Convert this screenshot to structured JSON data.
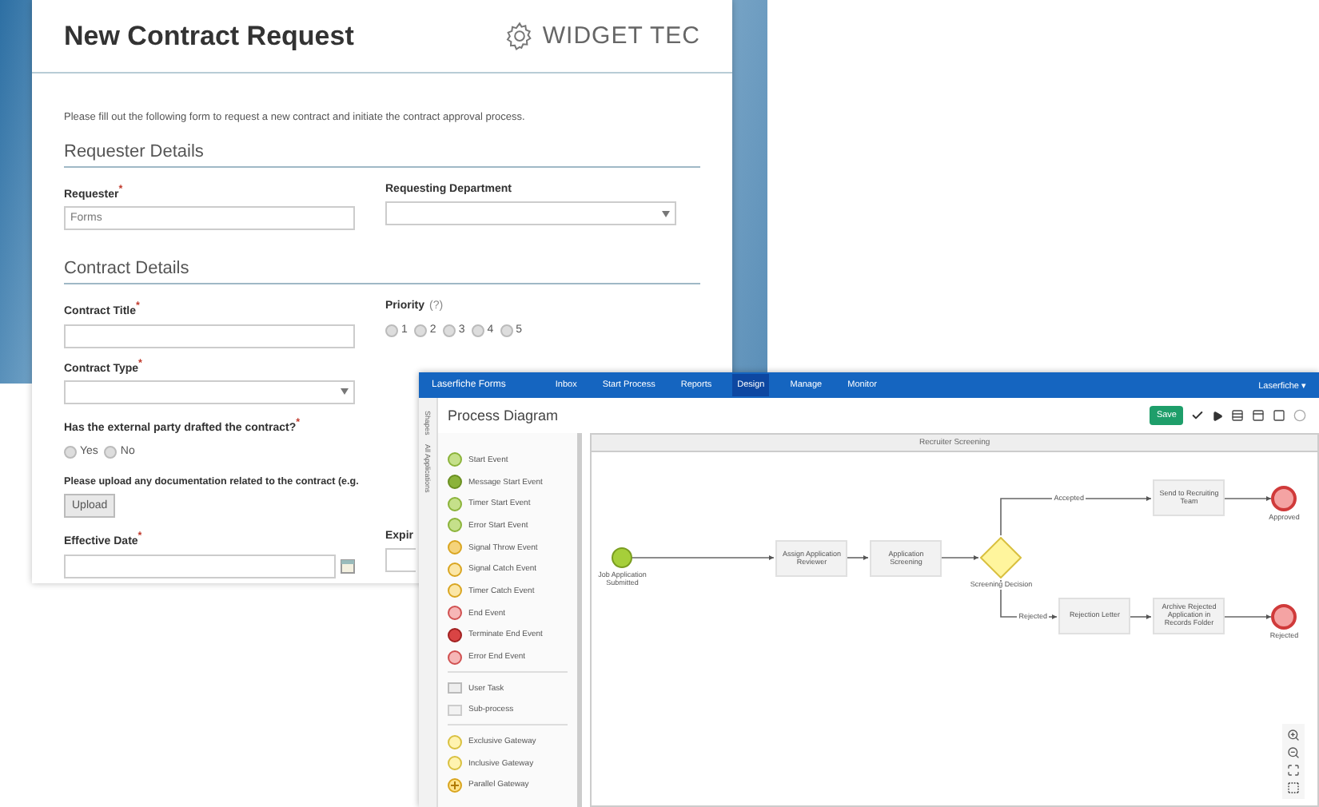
{
  "form": {
    "title": "New Contract Request",
    "brand": "WIDGET TEC",
    "intro": "Please fill out the following form to request a new contract and initiate the contract approval process.",
    "requester_section": "Requester Details",
    "requester": {
      "label": "Requester$^{*}$",
      "value": "Forms"
    },
    "department": {
      "label": "Requesting Department"
    },
    "contract_section": "Contract Details",
    "contract_title": {
      "label": "Contract Title$^{*}$"
    },
    "priority": {
      "label": "Priority",
      "hint": "(?)",
      "options": [
        {
          "label": "1",
          "selected": false
        },
        {
          "label": "2",
          "selected": false
        },
        {
          "label": "3",
          "selected": false
        },
        {
          "label": "4",
          "selected": false
        },
        {
          "label": "5",
          "selected": false
        }
      ]
    },
    "contract_type": {
      "label": "Contract Type$^{*}$"
    },
    "external_party": {
      "label": "Has the external party drafted the contract?$^{*}$",
      "options": [
        {
          "label": "Yes",
          "selected": false
        },
        {
          "label": "No",
          "selected": false
        }
      ]
    },
    "upload": {
      "label": "Please upload any documentation related to the contract (e.g.",
      "button": "Upload"
    },
    "effective_date": {
      "label": "Effective Date$^{*}$"
    },
    "expiration": {
      "label": "Expir"
    }
  },
  "designer": {
    "nav": {
      "brand": "Laserfiche Forms",
      "items": [
        {
          "label": "Inbox",
          "selected": false
        },
        {
          "label": "Start Process",
          "selected": false
        },
        {
          "label": "Reports",
          "selected": false
        },
        {
          "label": "Design",
          "selected": true
        },
        {
          "label": "Manage",
          "selected": false
        },
        {
          "label": "Monitor",
          "selected": false
        }
      ],
      "user": "Laserfiche ▾"
    },
    "side_tabs": [
      "Shapes",
      "All Applications"
    ],
    "title": "Process Diagram",
    "save": "Save",
    "palette_groups": [
      {
        "items": [
          {
            "label": "Start Event",
            "kind": "start"
          },
          {
            "label": "Message Start Event",
            "kind": "message-start"
          },
          {
            "label": "Timer Start Event",
            "kind": "timer-start"
          },
          {
            "label": "Error Start Event",
            "kind": "error-start"
          },
          {
            "label": "Signal Throw Event",
            "kind": "signal-throw"
          },
          {
            "label": "Signal Catch Event",
            "kind": "signal-catch"
          },
          {
            "label": "Timer Catch Event",
            "kind": "timer-catch"
          },
          {
            "label": "End Event",
            "kind": "end"
          },
          {
            "label": "Terminate End Event",
            "kind": "terminate-end"
          },
          {
            "label": "Error End Event",
            "kind": "error-end"
          }
        ]
      },
      {
        "items": [
          {
            "label": "User Task",
            "kind": "user-task"
          },
          {
            "label": "Sub-process",
            "kind": "sub-process"
          }
        ]
      },
      {
        "items": [
          {
            "label": "Exclusive Gateway",
            "kind": "exclusive-gateway"
          },
          {
            "label": "Inclusive Gateway",
            "kind": "inclusive-gateway"
          },
          {
            "label": "Parallel Gateway",
            "kind": "parallel-gateway"
          }
        ]
      }
    ],
    "lane": "Recruiter Screening",
    "nodes": [
      {
        "kind": "start",
        "label": "Job Application Submitted"
      },
      {
        "kind": "task",
        "label": "Assign Application Reviewer"
      },
      {
        "kind": "task",
        "label": "Application Screening"
      },
      {
        "kind": "gateway",
        "label": "Screening Decision"
      },
      {
        "kind": "task",
        "label": "Send to Recruiting Team"
      },
      {
        "kind": "end",
        "label": "Approved"
      },
      {
        "kind": "task",
        "label": "Rejection Letter"
      },
      {
        "kind": "task",
        "label": "Archive Rejected Application in Records Folder"
      },
      {
        "kind": "end",
        "label": "Rejected"
      }
    ],
    "flow_labels": [
      "Accepted",
      "Rejected"
    ]
  }
}
